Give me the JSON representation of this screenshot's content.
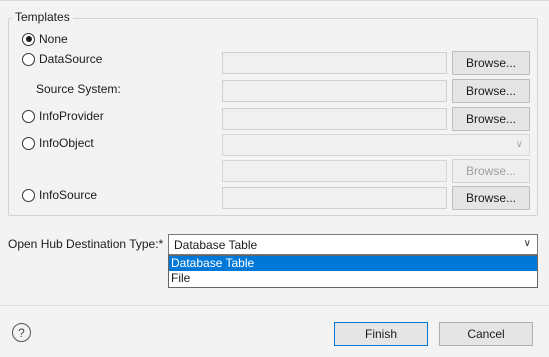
{
  "templates": {
    "title": "Templates",
    "options": {
      "none": "None",
      "datasource": "DataSource",
      "source_system": "Source System:",
      "infoprovider": "InfoProvider",
      "infoobject": "InfoObject",
      "infosource": "InfoSource"
    },
    "selected": "None",
    "browse_label": "Browse..."
  },
  "destination": {
    "label": "Open Hub Destination Type:*",
    "value": "Database Table",
    "options": [
      "Database Table",
      "File"
    ],
    "highlighted": "Database Table"
  },
  "footer": {
    "help_symbol": "?",
    "finish": "Finish",
    "cancel": "Cancel"
  },
  "colors": {
    "accent": "#0078d7",
    "background": "#f3f3f3"
  }
}
